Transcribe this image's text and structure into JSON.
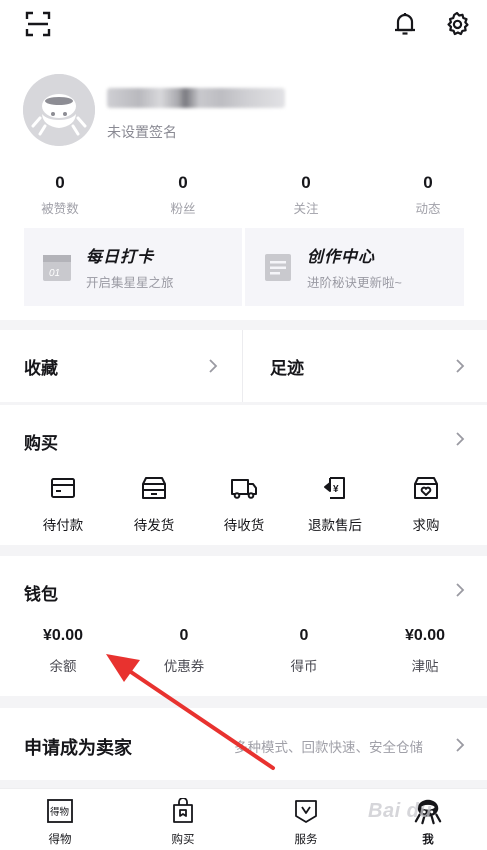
{
  "header": {
    "signature": "未设置签名"
  },
  "stats": [
    {
      "value": "0",
      "label": "被赞数"
    },
    {
      "value": "0",
      "label": "粉丝"
    },
    {
      "value": "0",
      "label": "关注"
    },
    {
      "value": "0",
      "label": "动态"
    }
  ],
  "promo": [
    {
      "title": "每日打卡",
      "subtitle": "开启集星星之旅",
      "icon_text": "01"
    },
    {
      "title": "创作中心",
      "subtitle": "进阶秘诀更新啦~"
    }
  ],
  "shortcuts": {
    "collect": "收藏",
    "footprint": "足迹"
  },
  "purchase": {
    "title": "购买",
    "items": [
      {
        "label": "待付款",
        "icon": "card-icon"
      },
      {
        "label": "待发货",
        "icon": "box-icon"
      },
      {
        "label": "待收货",
        "icon": "truck-icon"
      },
      {
        "label": "退款售后",
        "icon": "refund-icon",
        "icon_text": "¥"
      },
      {
        "label": "求购",
        "icon": "basket-heart-icon"
      }
    ]
  },
  "wallet": {
    "title": "钱包",
    "items": [
      {
        "value": "¥0.00",
        "label": "余额"
      },
      {
        "value": "0",
        "label": "优惠券"
      },
      {
        "value": "0",
        "label": "得币"
      },
      {
        "value": "¥0.00",
        "label": "津贴"
      }
    ]
  },
  "seller": {
    "title": "申请成为卖家",
    "subtitle": "多种模式、回款快速、安全仓储"
  },
  "tabs": [
    {
      "label": "得物",
      "icon_text": "得物"
    },
    {
      "label": "购买"
    },
    {
      "label": "服务"
    },
    {
      "label": "我"
    }
  ],
  "watermark": "Bai du",
  "colors": {
    "background": "#f4f4f6",
    "card": "#ffffff",
    "text": "#16161a",
    "muted": "#a0a0a8",
    "annotation_arrow": "#e8322f"
  }
}
